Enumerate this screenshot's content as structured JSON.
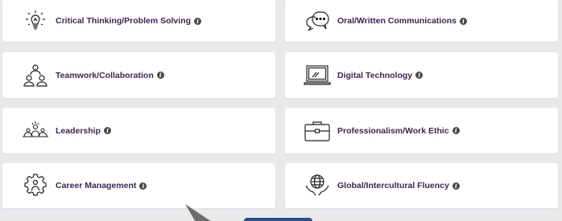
{
  "cards": [
    {
      "label": "Critical Thinking/Problem Solving",
      "icon": "lightbulb-icon"
    },
    {
      "label": "Oral/Written Communications",
      "icon": "speech-bubbles-icon"
    },
    {
      "label": "Teamwork/Collaboration",
      "icon": "team-icon"
    },
    {
      "label": "Digital Technology",
      "icon": "laptop-icon"
    },
    {
      "label": "Leadership",
      "icon": "leadership-group-icon"
    },
    {
      "label": "Professionalism/Work Ethic",
      "icon": "briefcase-icon"
    },
    {
      "label": "Career Management",
      "icon": "gear-person-icon"
    },
    {
      "label": "Global/Intercultural Fluency",
      "icon": "globe-hands-icon"
    }
  ],
  "info_glyph": "i",
  "colors": {
    "background": "#e9e9ec",
    "card": "#ffffff",
    "label": "#3c2456",
    "info_badge": "#4a4a4a",
    "bottom_button": "#2e4e8a"
  }
}
